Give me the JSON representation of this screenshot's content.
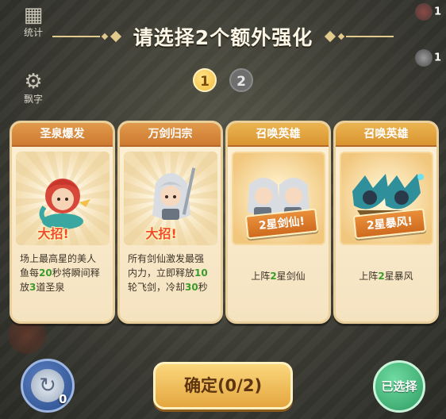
{
  "left_menu": {
    "stats_label": "统计",
    "word_label": "飘字"
  },
  "right_hud": {
    "count_top": "1",
    "count_mid": "1"
  },
  "title": "请选择2个额外强化",
  "steps": [
    "1",
    "2"
  ],
  "cards": [
    {
      "header": "圣泉爆发",
      "tag": "大招!",
      "desc_parts": [
        "场上最高星的美人鱼每",
        "20",
        "秒将瞬间释放",
        "3",
        "道圣泉"
      ]
    },
    {
      "header": "万剑归宗",
      "tag": "大招!",
      "desc_parts": [
        "所有剑仙激发最强内力，立即释放",
        "10",
        "轮飞剑，冷却",
        "30",
        "秒"
      ]
    },
    {
      "header": "召唤英雄",
      "banner": "2星剑仙!",
      "desc_parts": [
        "上阵",
        "2",
        "星剑仙"
      ]
    },
    {
      "header": "召唤英雄",
      "banner": "2星暴风!",
      "desc_parts": [
        "上阵",
        "2",
        "星暴风"
      ]
    }
  ],
  "buttons": {
    "refresh_count": "0",
    "confirm": "确定(0/2)",
    "selected": "已选择"
  },
  "colors": {
    "card_header": "#d98a3e",
    "highlight_green": "#3a9b2a",
    "confirm_gold": "#f0bd5a",
    "selected_green": "#3fb276",
    "ult_red": "#f04a35"
  }
}
